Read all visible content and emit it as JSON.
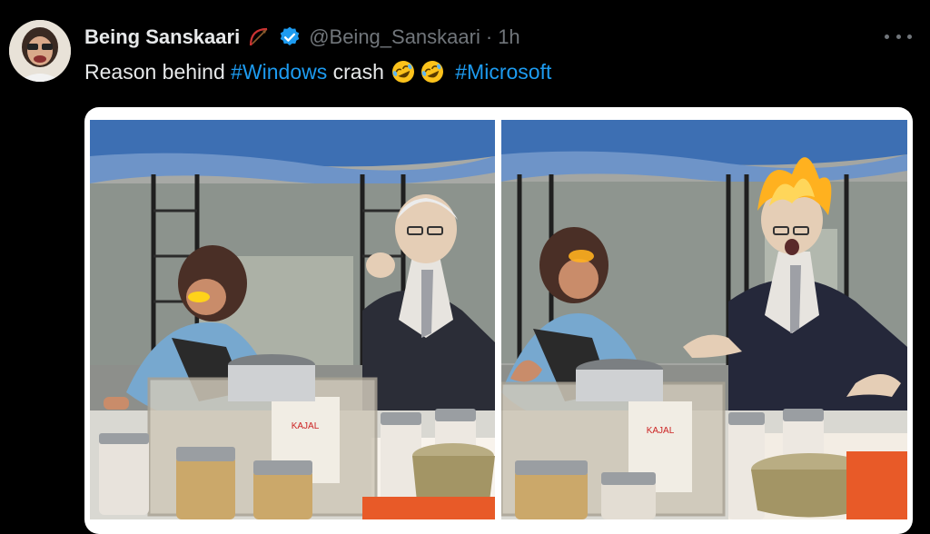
{
  "tweet": {
    "author": {
      "display_name": "Being Sanskaari",
      "handle": "@Being_Sanskaari",
      "verified": true,
      "badge_icon": "bow-and-arrow-icon",
      "avatar_icon": "avatar-photo"
    },
    "separator": "·",
    "time": "1h",
    "text": {
      "part1": "Reason behind ",
      "hashtag1": "#Windows",
      "part2": " crash ",
      "emoji_icon": "rolling-on-floor-laughing-icon",
      "hashtag2": "#Microsoft"
    },
    "media": {
      "frames": [
        "left-frame",
        "right-frame"
      ],
      "jar_label_text": "KAJAL"
    }
  },
  "colors": {
    "background": "#000000",
    "text_primary": "#e7e9ea",
    "text_secondary": "#71767b",
    "link": "#1d9bf0",
    "verified": "#1d9bf0"
  }
}
